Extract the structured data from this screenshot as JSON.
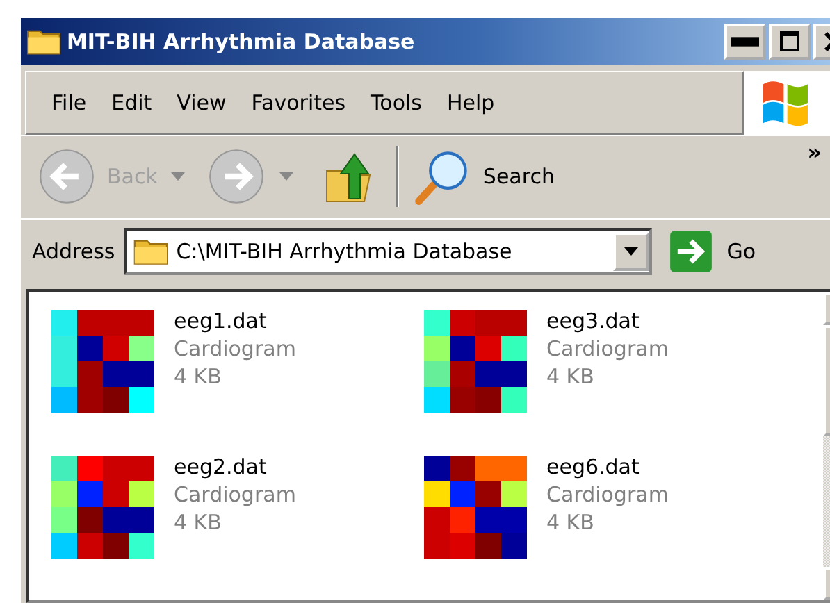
{
  "window": {
    "title": "MIT-BIH Arrhythmia Database"
  },
  "menu": [
    "File",
    "Edit",
    "View",
    "Favorites",
    "Tools",
    "Help"
  ],
  "toolbar": {
    "back": {
      "label": "Back",
      "disabled": true
    },
    "forward": {
      "disabled": true
    },
    "search": "Search",
    "chevron": "»"
  },
  "address": {
    "label": "Address",
    "value": "C:\\MIT-BIH Arrhythmia Database",
    "go": "Go"
  },
  "files": [
    {
      "name": "eeg1.dat",
      "type": "Cardiogram",
      "size": "4 KB"
    },
    {
      "name": "eeg3.dat",
      "type": "Cardiogram",
      "size": "4 KB"
    },
    {
      "name": "eeg2.dat",
      "type": "Cardiogram",
      "size": "4 KB"
    },
    {
      "name": "eeg6.dat",
      "type": "Cardiogram",
      "size": "4 KB"
    }
  ]
}
